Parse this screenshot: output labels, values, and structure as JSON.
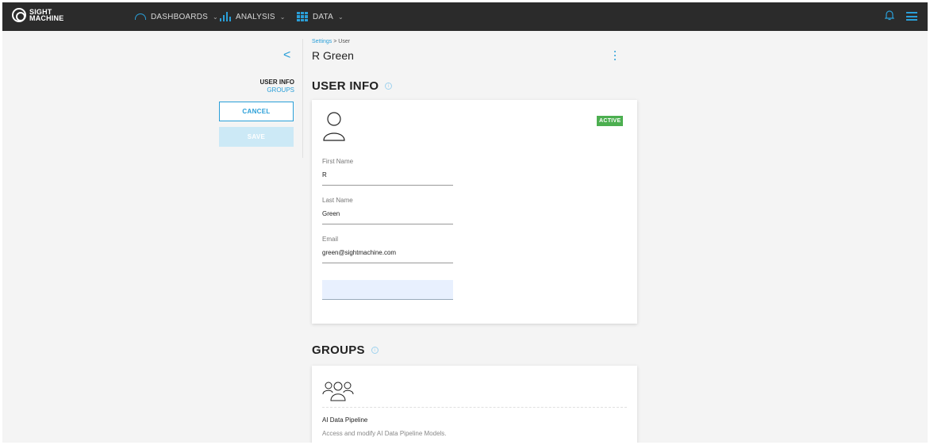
{
  "nav": {
    "logo_line1": "SIGHT",
    "logo_line2": "MACHINE",
    "dashboards": "DASHBOARDS",
    "analysis": "ANALYSIS",
    "data": "DATA",
    "chevron": "⌄"
  },
  "sidebar": {
    "back": "<",
    "user_info": "USER INFO",
    "groups": "GROUPS",
    "cancel": "CANCEL",
    "save": "SAVE"
  },
  "header": {
    "breadcrumb_root": "Settings",
    "breadcrumb_sep": " > ",
    "breadcrumb_current": "User",
    "title": "R Green"
  },
  "user_info": {
    "section_title": "USER INFO",
    "status": "ACTIVE",
    "first_name_label": "First Name",
    "first_name": "R",
    "last_name_label": "Last Name",
    "last_name": "Green",
    "email_label": "Email",
    "email": "green@sightmachine.com"
  },
  "groups": {
    "section_title": "GROUPS",
    "items": [
      {
        "name": "AI Data Pipeline",
        "description": "Access and modify AI Data Pipeline Models."
      }
    ]
  },
  "colors": {
    "accent": "#2a9fd8",
    "topbar": "#2b2b2b",
    "active_badge": "#4caf50"
  }
}
